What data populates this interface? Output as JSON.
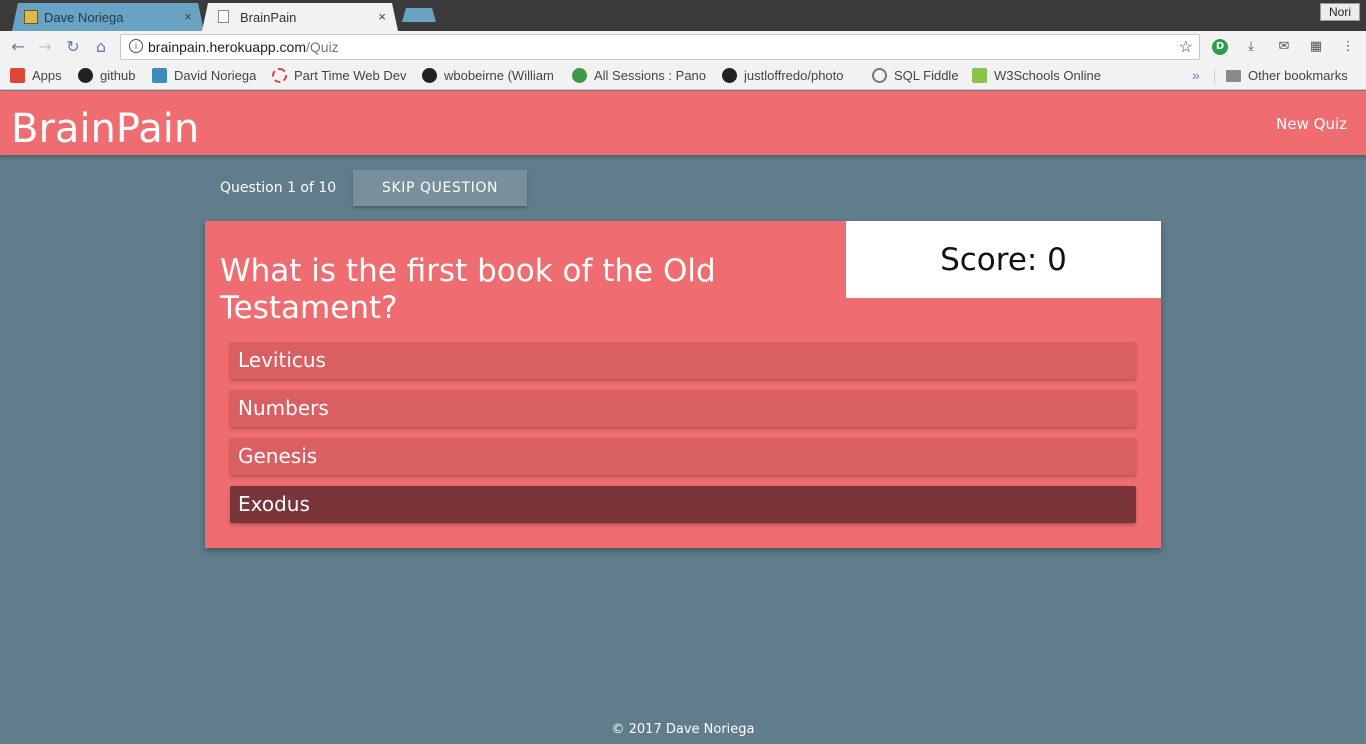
{
  "browser": {
    "tabs": [
      {
        "title": "Dave Noriega",
        "close": "×"
      },
      {
        "title": "BrainPain",
        "close": "×"
      }
    ],
    "profile_name": "Nori",
    "url_host": "brainpain.herokuapp.com",
    "url_path": "/Quiz",
    "bookmarks": [
      {
        "label": "Apps",
        "icon": "apps-grid-icon",
        "color": "#e0453a"
      },
      {
        "label": "github",
        "icon": "github-icon",
        "color": "#222222"
      },
      {
        "label": "David Noriega",
        "icon": "profile-icon",
        "color": "#3c8dbc"
      },
      {
        "label": "Part Time Web Dev",
        "icon": "dashed-circle-icon",
        "color": "#e0453a"
      },
      {
        "label": "wbobeirne (William",
        "icon": "github-icon",
        "color": "#222222"
      },
      {
        "label": "All Sessions : Pano",
        "icon": "clover-icon",
        "color": "#3d9a48"
      },
      {
        "label": "justloffredo/photo",
        "icon": "github-icon",
        "color": "#222222"
      },
      {
        "label": "SQL Fiddle",
        "icon": "shell-icon",
        "color": "#777777"
      },
      {
        "label": "W3Schools Online",
        "icon": "w3-icon",
        "color": "#8bc34a"
      }
    ],
    "more_bookmarks": "»",
    "other_bookmarks": "Other bookmarks"
  },
  "app": {
    "brand": "BrainPain",
    "nav_new_quiz": "New Quiz",
    "question_progress": "Question 1 of 10",
    "skip_label": "SKIP QUESTION",
    "question": "What is the first book of the Old Testament?",
    "score_text": "Score: 0",
    "answers": [
      "Leviticus",
      "Numbers",
      "Genesis",
      "Exodus"
    ],
    "selected_answer": "Exodus",
    "footer": "© 2017 Dave Noriega"
  },
  "colors": {
    "page_bg": "#607d8b",
    "primary": "#ef6c70",
    "answer_bg": "#d95f63",
    "answer_selected": "#7a3538",
    "skip_bg": "#78909c"
  }
}
